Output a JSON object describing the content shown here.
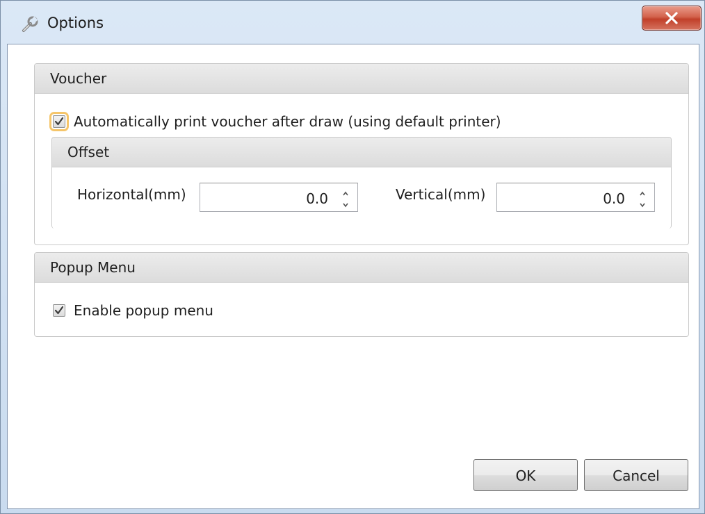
{
  "window": {
    "title": "Options",
    "icon": "wrench-icon",
    "close_icon": "close-icon"
  },
  "voucher": {
    "header": "Voucher",
    "auto_print": {
      "label": "Automatically print voucher after draw (using default printer)",
      "checked": true
    },
    "offset": {
      "header": "Offset",
      "horizontal_label": "Horizontal(mm)",
      "horizontal_value": "0.0",
      "vertical_label": "Vertical(mm)",
      "vertical_value": "0.0"
    }
  },
  "popup_menu": {
    "header": "Popup Menu",
    "enable": {
      "label": "Enable popup menu",
      "checked": true
    }
  },
  "buttons": {
    "ok": "OK",
    "cancel": "Cancel"
  },
  "colors": {
    "close_button": "#c1402a",
    "focus_ring": "#f5c56a",
    "frame": "#c9dbef"
  }
}
